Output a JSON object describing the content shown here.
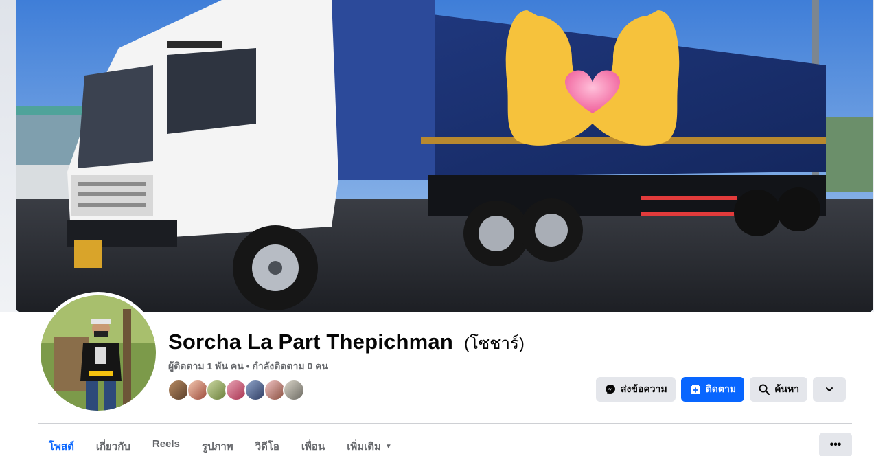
{
  "profile": {
    "name": "Sorcha La Part Thepichman",
    "alternate_name": "(โซชาร์)",
    "stats": "ผู้ติดตาม 1 พัน คน • กำลังติดตาม 0 คน"
  },
  "actions": {
    "message_label": "ส่งข้อความ",
    "follow_label": "ติดตาม",
    "search_label": "ค้นหา"
  },
  "tabs": [
    {
      "label": "โพสต์",
      "active": true
    },
    {
      "label": "เกี่ยวกับ",
      "active": false
    },
    {
      "label": "Reels",
      "active": false
    },
    {
      "label": "รูปภาพ",
      "active": false
    },
    {
      "label": "วิดีโอ",
      "active": false
    },
    {
      "label": "เพื่อน",
      "active": false
    },
    {
      "label": "เพิ่มเติม",
      "active": false
    }
  ],
  "icons": {
    "message": "messenger-icon",
    "follow": "follow-plus-icon",
    "search": "search-icon",
    "expand": "chevron-down-icon",
    "more_tab": "ellipsis-icon"
  },
  "colors": {
    "accent": "#0866ff",
    "button_bg": "#e4e6eb",
    "secondary_text": "#65676b"
  }
}
